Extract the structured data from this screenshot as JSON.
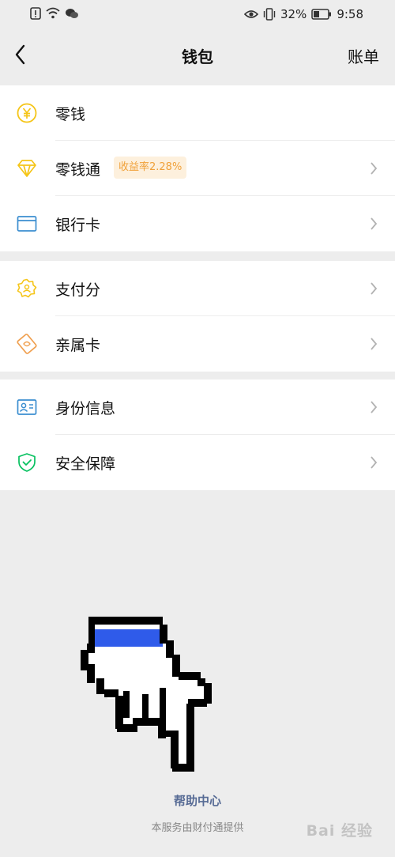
{
  "statusbar": {
    "battery_pct": "32%",
    "time": "9:58",
    "icons": [
      "alert-icon",
      "wifi-icon",
      "wechat-icon",
      "eye-icon",
      "vibrate-icon",
      "battery-icon"
    ]
  },
  "navbar": {
    "title": "钱包",
    "right_link": "账单"
  },
  "groups": [
    {
      "items": [
        {
          "label": "零钱",
          "icon": "yuan-icon"
        },
        {
          "label": "零钱通",
          "icon": "diamond-icon",
          "badge": "收益率2.28%"
        },
        {
          "label": "银行卡",
          "icon": "card-icon"
        }
      ]
    },
    {
      "items": [
        {
          "label": "支付分",
          "icon": "pay-score-icon"
        },
        {
          "label": "亲属卡",
          "icon": "family-card-icon"
        }
      ]
    },
    {
      "items": [
        {
          "label": "身份信息",
          "icon": "id-card-icon"
        },
        {
          "label": "安全保障",
          "icon": "shield-icon"
        }
      ]
    }
  ],
  "footer": {
    "help_center": "帮助中心",
    "provider_text": "本服务由财付通提供",
    "watermark": "Bai 经验"
  },
  "colors": {
    "link": "#576b95",
    "badge_text": "#f0a13a",
    "badge_bg": "#fdf0dd",
    "yellow_icon": "#f5c518",
    "blue_icon": "#3b8ed0",
    "orange_icon": "#f0a050",
    "green_icon": "#07c160"
  }
}
